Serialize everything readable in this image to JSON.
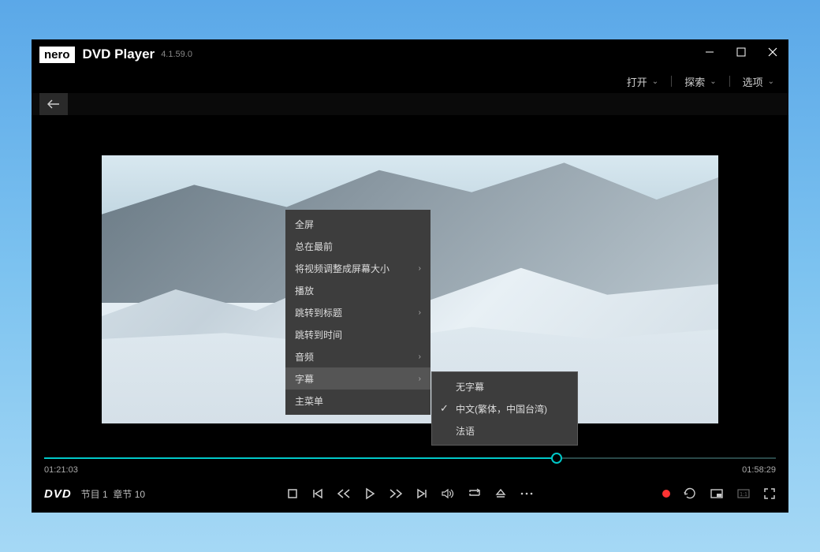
{
  "app": {
    "brand": "nero",
    "title": "DVD Player",
    "version": "4.1.59.0"
  },
  "menubar": {
    "open": "打开",
    "explore": "探索",
    "options": "选项"
  },
  "context_menu": {
    "items": [
      {
        "label": "全屏",
        "has_sub": false
      },
      {
        "label": "总在最前",
        "has_sub": false
      },
      {
        "label": "将视频调整成屏幕大小",
        "has_sub": true
      },
      {
        "label": "播放",
        "has_sub": false
      },
      {
        "label": "跳转到标题",
        "has_sub": true
      },
      {
        "label": "跳转到时间",
        "has_sub": false
      },
      {
        "label": "音频",
        "has_sub": true
      },
      {
        "label": "字幕",
        "has_sub": true,
        "active": true
      },
      {
        "label": "主菜单",
        "has_sub": false
      }
    ]
  },
  "submenu": {
    "items": [
      {
        "label": "无字幕",
        "checked": false
      },
      {
        "label": "中文(繁体，中国台湾)",
        "checked": true
      },
      {
        "label": "法语",
        "checked": false
      }
    ]
  },
  "playback": {
    "elapsed": "01:21:03",
    "total": "01:58:29",
    "progress_pct": 70,
    "disc_label": "DVD",
    "title_label": "节目 1",
    "chapter_label": "章节 10"
  },
  "colors": {
    "accent": "#00c8c8",
    "record": "#ff3333"
  }
}
